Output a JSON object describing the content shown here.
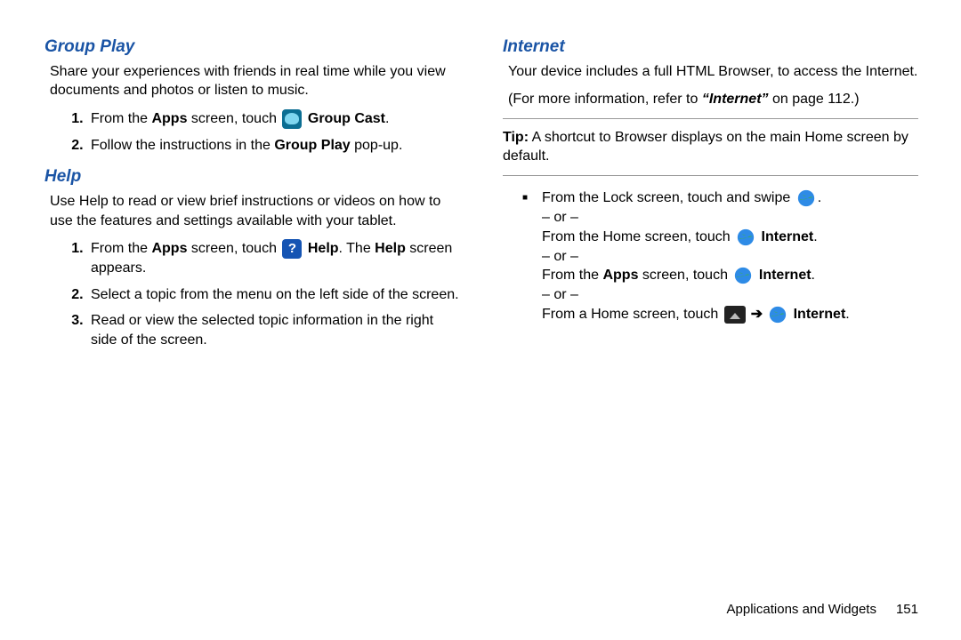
{
  "left": {
    "groupplay": {
      "heading": "Group Play",
      "intro": "Share your experiences with friends in real time while you view documents and photos or listen to music.",
      "step1_a": "From the ",
      "step1_b": "Apps",
      "step1_c": " screen, touch ",
      "step1_d": "Group Cast",
      "step1_e": ".",
      "step2_a": "Follow the instructions in the ",
      "step2_b": "Group Play",
      "step2_c": " pop-up."
    },
    "help": {
      "heading": "Help",
      "intro": "Use Help to read or view brief instructions or videos on how to use the features and settings available with your tablet.",
      "step1_a": "From the ",
      "step1_b": "Apps",
      "step1_c": " screen, touch ",
      "step1_d": "Help",
      "step1_e": ". The ",
      "step1_f": "Help",
      "step1_g": " screen appears.",
      "step2": "Select a topic from the menu on the left side of the screen.",
      "step3": "Read or view the selected topic information in the right side of the screen."
    }
  },
  "right": {
    "internet": {
      "heading": "Internet",
      "intro": "Your device includes a full HTML Browser, to access the Internet.",
      "refer_a": "(For more information, refer to ",
      "refer_b": "“Internet”",
      "refer_c": " on page 112.)",
      "tip_a": "Tip:",
      "tip_b": " A shortcut to Browser displays on the main Home screen by default.",
      "b1_a": "From the Lock screen, touch and swipe ",
      "b1_b": ".",
      "or": "– or –",
      "b2_a": "From the Home screen, touch ",
      "b2_b": "Internet",
      "b2_c": ".",
      "b3_a": "From the ",
      "b3_b": "Apps",
      "b3_c": " screen, touch ",
      "b3_d": "Internet",
      "b3_e": ".",
      "b4_a": "From a Home screen, touch ",
      "b4_b": "Internet",
      "b4_c": "."
    }
  },
  "footer": {
    "section": "Applications and Widgets",
    "page": "151"
  }
}
